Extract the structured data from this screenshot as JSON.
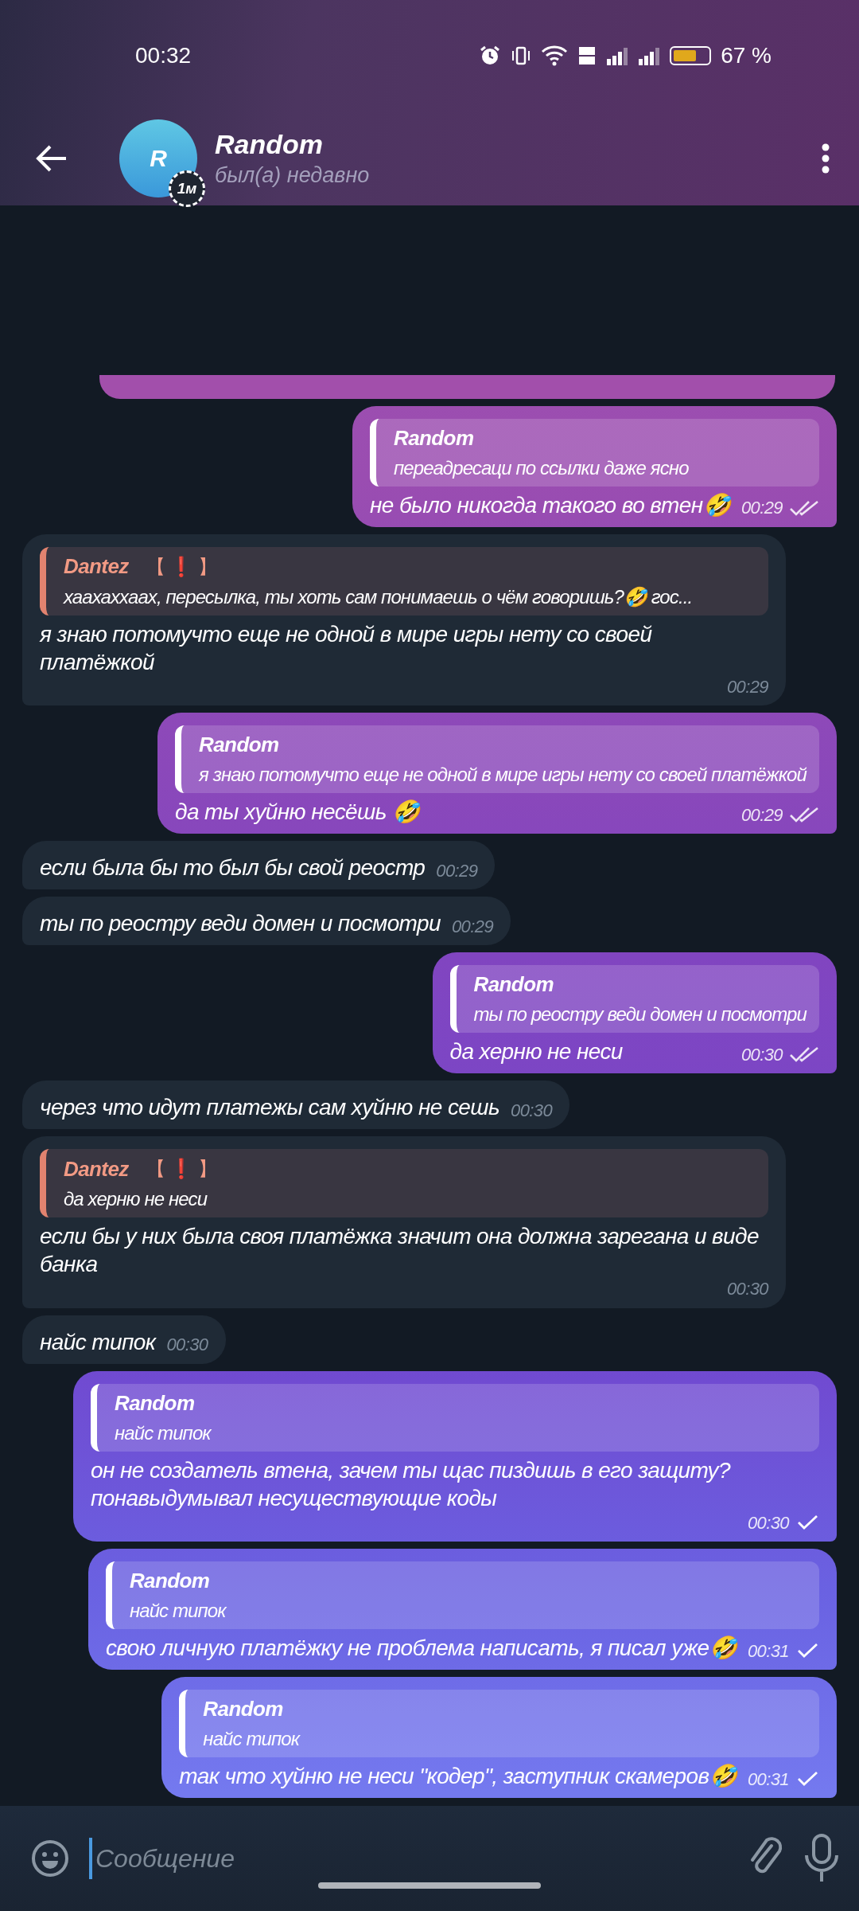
{
  "status_bar": {
    "time": "00:32",
    "battery_text": "67 %"
  },
  "header": {
    "name": "Random",
    "avatar_letter": "R",
    "story_badge": "1м",
    "status": "был(а) недавно"
  },
  "messages": [
    {
      "outgoing": true,
      "reply": {
        "kind": "own",
        "author": "Random",
        "text": "переадресаци по ссылки даже ясно"
      },
      "text": "не было никогда такого во втен🤣",
      "time": "00:29",
      "read": true
    },
    {
      "outgoing": false,
      "reply": {
        "kind": "peer",
        "author": "Dantez",
        "badge": "【 ❗ 】",
        "text": "хаахаххаах, пересылка, ты хоть сам понимаешь о чём говоришь?🤣 гос..."
      },
      "text": "я знаю потомучто еще не одной в мире игры нету со своей платёжкой",
      "time": "00:29"
    },
    {
      "outgoing": true,
      "reply": {
        "kind": "own",
        "author": "Random",
        "text": "я знаю потомучто еще не одной в мире игры нету со своей платёжкой"
      },
      "text": "да ты хуйню несёшь 🤣",
      "time": "00:29",
      "read": true
    },
    {
      "outgoing": false,
      "text": "если была бы то был бы свой реостр",
      "time": "00:29"
    },
    {
      "outgoing": false,
      "text": "ты по реостру веди домен и посмотри",
      "time": "00:29"
    },
    {
      "outgoing": true,
      "reply": {
        "kind": "own",
        "author": "Random",
        "text": "ты по реостру веди домен и посмотри"
      },
      "text": "да херню не неси",
      "time": "00:30",
      "read": true
    },
    {
      "outgoing": false,
      "text": "через что идут платежы сам хуйню не сешь",
      "time": "00:30"
    },
    {
      "outgoing": false,
      "reply": {
        "kind": "peer",
        "author": "Dantez",
        "badge": "【 ❗ 】",
        "text": "да херню не неси"
      },
      "text": "если бы у них была своя платёжка значит она должна зарегана и виде банка",
      "time": "00:30"
    },
    {
      "outgoing": false,
      "text": "найс типок",
      "time": "00:30"
    },
    {
      "outgoing": true,
      "reply": {
        "kind": "own",
        "author": "Random",
        "text": "найс типок"
      },
      "text": "он не создатель втена, зачем ты щас пиздишь в его защиту? понавыдумывал несуществующие коды",
      "time": "00:30",
      "read": false
    },
    {
      "outgoing": true,
      "reply": {
        "kind": "own",
        "author": "Random",
        "text": "найс типок"
      },
      "text": "свою личную платёжку не проблема написать, я писал уже🤣",
      "time": "00:31",
      "read": false
    },
    {
      "outgoing": true,
      "reply": {
        "kind": "own",
        "author": "Random",
        "text": "найс типок"
      },
      "text": "так что хуйню не неси \"кодер\", заступник скамеров🤣",
      "time": "00:31",
      "read": false
    }
  ],
  "composer": {
    "placeholder": "Сообщение"
  }
}
